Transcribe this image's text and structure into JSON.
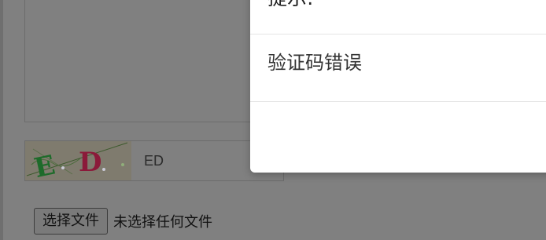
{
  "modal": {
    "title": "提示:",
    "message": "验证码错误"
  },
  "captcha": {
    "image_text": "ED",
    "value": "ED"
  },
  "file_input": {
    "button_label": "选择文件",
    "status": "未选择任何文件"
  },
  "colors": {
    "backdrop": "#808080",
    "modal_bg": "#ffffff",
    "captcha_letter_e": "#1e6b2a",
    "captcha_letter_d": "#8b1a3a"
  }
}
